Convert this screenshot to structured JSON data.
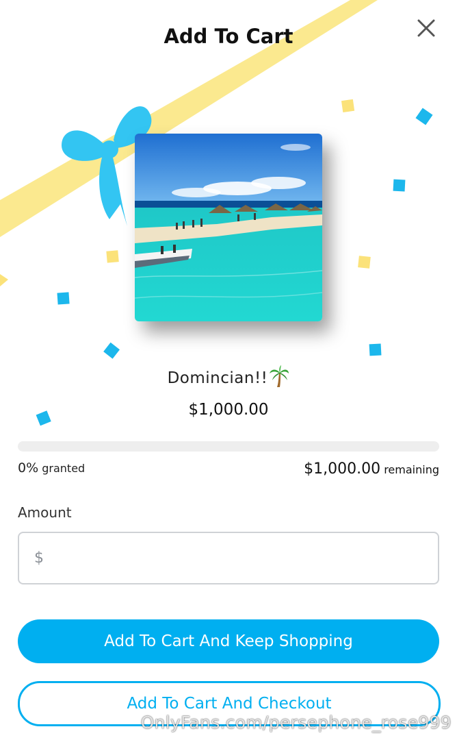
{
  "modal": {
    "title": "Add To Cart",
    "close_icon": "close-icon"
  },
  "gift": {
    "product_name": "Domincian!!",
    "product_emoji": "palm-tree-icon",
    "price": "$1,000.00",
    "progress_fraction": 0,
    "granted_percent": "0%",
    "granted_label": "granted",
    "remaining_amount": "$1,000.00",
    "remaining_label": "remaining"
  },
  "amount": {
    "label": "Amount",
    "currency_symbol": "$",
    "value": "",
    "placeholder": ""
  },
  "buttons": {
    "keep_shopping": "Add To Cart And Keep Shopping",
    "checkout": "Add To Cart And Checkout"
  },
  "watermark": "OnlyFans.com/persephone_rose999",
  "colors": {
    "accent": "#00aff0",
    "ribbon": "#fbe98f",
    "bow": "#33c5f2",
    "confetti_yellow": "#fbe27a",
    "confetti_blue": "#1cb7ec"
  }
}
